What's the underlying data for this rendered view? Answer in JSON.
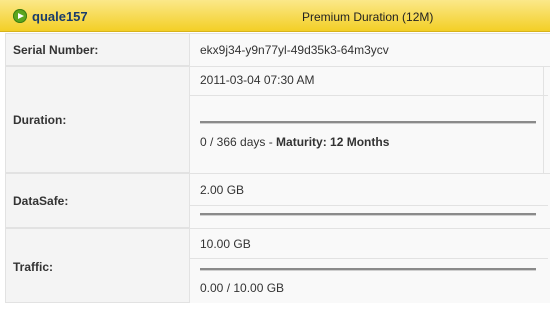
{
  "header": {
    "account_name": "quale157",
    "plan_name": "Premium Duration (12M)"
  },
  "serial": {
    "label": "Serial Number:",
    "value": "ekx9j34-y9n77yl-49d35k3-64m3ycv"
  },
  "duration": {
    "label": "Duration:",
    "start": "2011-03-04 07:30 AM",
    "progress_text_prefix": "0 / 366 days - ",
    "maturity_label": "Maturity: 12 Months",
    "progress_fraction": 0
  },
  "datasafe": {
    "label": "DataSafe:",
    "value": "2.00 GB",
    "progress_fraction": 0
  },
  "traffic": {
    "label": "Traffic:",
    "value": "10.00 GB",
    "usage": "0.00 / 10.00 GB",
    "progress_fraction": 0
  },
  "colors": {
    "header_bg": "#f3cf26",
    "accent_green": "#5aa61f",
    "account_text": "#1a3c6b"
  },
  "icons": {
    "play": "play-icon"
  }
}
